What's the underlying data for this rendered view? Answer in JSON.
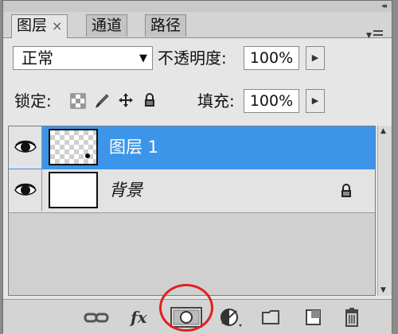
{
  "tabs": [
    {
      "label": "图层",
      "close": "×",
      "active": true
    },
    {
      "label": "通道",
      "active": false
    },
    {
      "label": "路径",
      "active": false
    }
  ],
  "collapse": "◂◂",
  "blend_mode": "正常",
  "opacity": {
    "label": "不透明度:",
    "value": "100%"
  },
  "lock": {
    "label": "锁定:"
  },
  "fill": {
    "label": "填充:",
    "value": "100%"
  },
  "layers": [
    {
      "name": "图层 1",
      "selected": true,
      "visible": true,
      "thumbnail": "transparent-checkerboard"
    },
    {
      "name": "背景",
      "selected": false,
      "visible": true,
      "thumbnail": "white",
      "locked": true
    }
  ],
  "bottom_toolbar": [
    "link-layers-icon",
    "fx-icon",
    "layer-mask-icon",
    "adjustment-layer-icon",
    "new-group-icon",
    "new-layer-icon",
    "trash-icon"
  ],
  "fx_label": "fx",
  "colors": {
    "selection": "#3d95e9",
    "highlight_ring": "#e02020",
    "panel": "#d4d4d4"
  }
}
